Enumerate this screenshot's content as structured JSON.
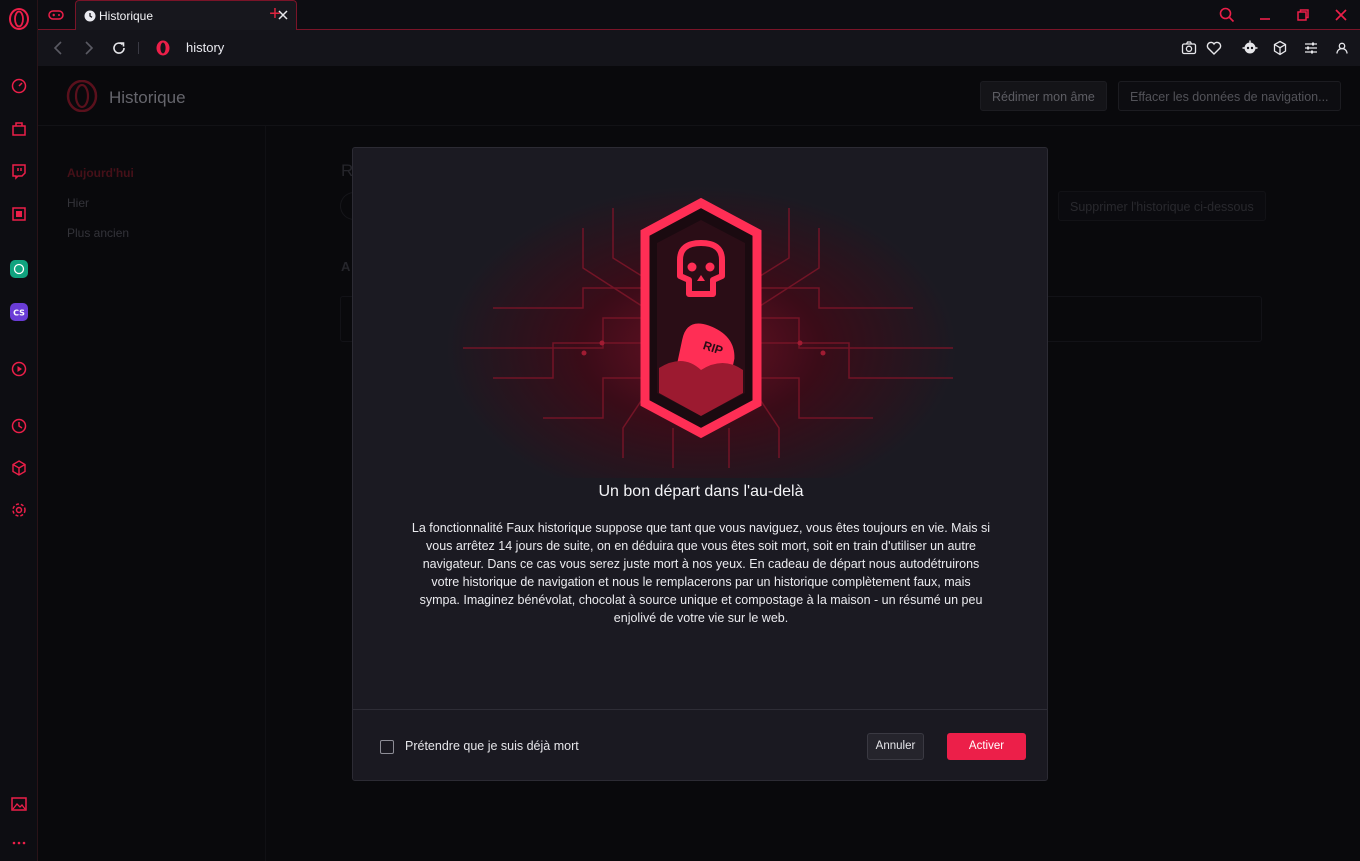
{
  "colors": {
    "accent": "#ec1f49",
    "background": "#0e0e13",
    "dialog": "#1b1a22"
  },
  "tabs": [
    {
      "title": "Historique",
      "icon": "clock-icon",
      "active": true
    }
  ],
  "address_bar": {
    "url": "history"
  },
  "sidebar": {
    "items": [
      {
        "icon": "speed-dial-icon"
      },
      {
        "icon": "game-icon"
      },
      {
        "icon": "twitch-icon"
      },
      {
        "icon": "cpu-limiter-icon"
      },
      {
        "icon": "chatgpt-icon"
      },
      {
        "icon": "cs-icon"
      },
      {
        "icon": "player-icon"
      },
      {
        "icon": "history-icon"
      },
      {
        "icon": "cube-icon"
      },
      {
        "icon": "settings-icon"
      },
      {
        "icon": "wallpaper-icon"
      },
      {
        "icon": "more-icon"
      }
    ]
  },
  "page": {
    "title": "Historique",
    "redeem_button": "Rédimer mon âme",
    "clear_data_button": "Effacer les données de navigation...",
    "nav": [
      "Aujourd'hui",
      "Hier",
      "Plus ancien"
    ],
    "delete_below_button": "Supprimer l'historique ci-dessous",
    "bg_heading_r": "R",
    "bg_heading_a": "A"
  },
  "dialog": {
    "badge_text": "RIP",
    "title": "Un bon départ dans l'au-delà",
    "body": "La fonctionnalité Faux historique suppose que tant que vous naviguez, vous êtes toujours en vie. Mais si vous arrêtez 14 jours de suite, on en déduira que vous êtes soit mort, soit en train d'utiliser un autre navigateur. Dans ce cas vous serez juste mort à nos yeux. En cadeau de départ nous autodétruirons votre historique de navigation et nous le remplacerons par un historique complètement faux, mais sympa. Imaginez bénévolat, chocolat à source unique et compostage à la maison - un résumé un peu enjolivé de votre vie sur le web.",
    "checkbox_label": "Prétendre que je suis déjà mort",
    "checkbox_checked": false,
    "cancel_button": "Annuler",
    "activate_button": "Activer"
  }
}
